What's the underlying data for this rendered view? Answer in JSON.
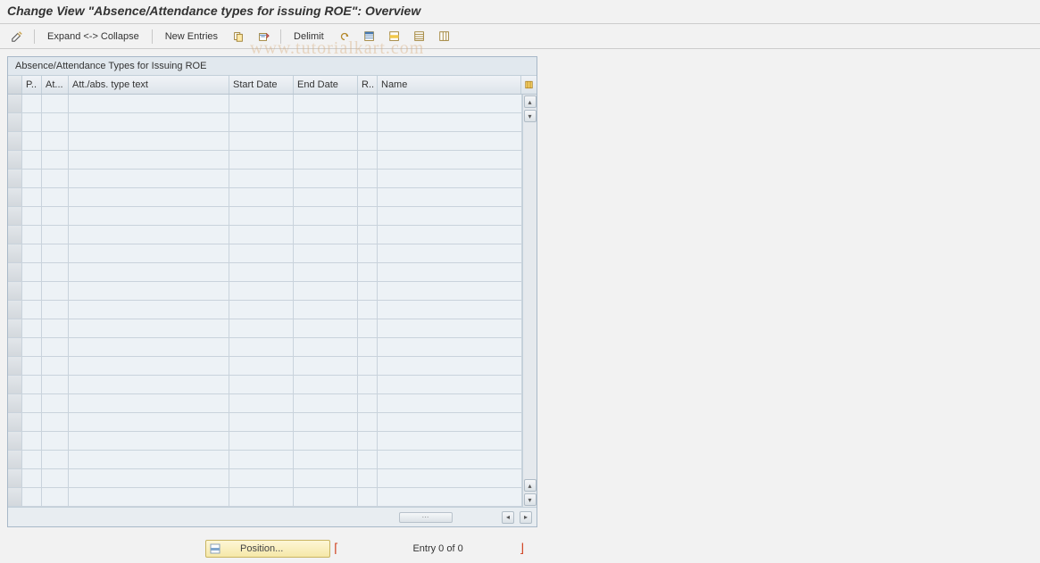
{
  "title": "Change View \"Absence/Attendance types for issuing ROE\": Overview",
  "toolbar": {
    "display_change": "Display/Change",
    "expand_collapse": "Expand <-> Collapse",
    "new_entries": "New Entries",
    "copy": "Copy",
    "delete": "Delete",
    "delimit": "Delimit",
    "undo": "Undo",
    "select_all": "Select All",
    "select_block": "Select Block",
    "deselect_all": "Deselect All",
    "config": "Configuration"
  },
  "grid": {
    "title": "Absence/Attendance Types for Issuing ROE",
    "columns": {
      "p": "P..",
      "at": "At...",
      "type_text": "Att./abs. type text",
      "start_date": "Start Date",
      "end_date": "End Date",
      "r": "R..",
      "name": "Name"
    },
    "row_count": 22
  },
  "footer": {
    "position_label": "Position...",
    "entry_label": "Entry 0 of 0"
  },
  "watermark": "www.tutorialkart.com"
}
